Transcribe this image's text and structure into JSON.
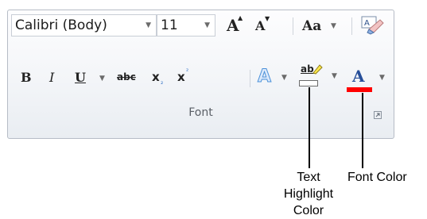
{
  "ribbon": {
    "group_label": "Font",
    "font_name": "Calibri (Body)",
    "font_size": "11",
    "row1": {
      "grow_font": "A",
      "shrink_font": "A",
      "change_case": "Aa",
      "clear_formatting": "A"
    },
    "row2": {
      "bold": "B",
      "italic": "I",
      "underline": "U",
      "strikethrough": "abc",
      "subscript": "x",
      "superscript": "x",
      "text_effects": "A",
      "highlight": "ab",
      "font_color": "A"
    },
    "colors": {
      "highlight_swatch": "#ffffff",
      "font_color_swatch": "#ff0000",
      "text_effect_blue": "#4a90d9"
    }
  },
  "callouts": {
    "text_highlight_color": [
      "Text",
      "Highlight",
      "Color"
    ],
    "font_color": "Font Color"
  }
}
